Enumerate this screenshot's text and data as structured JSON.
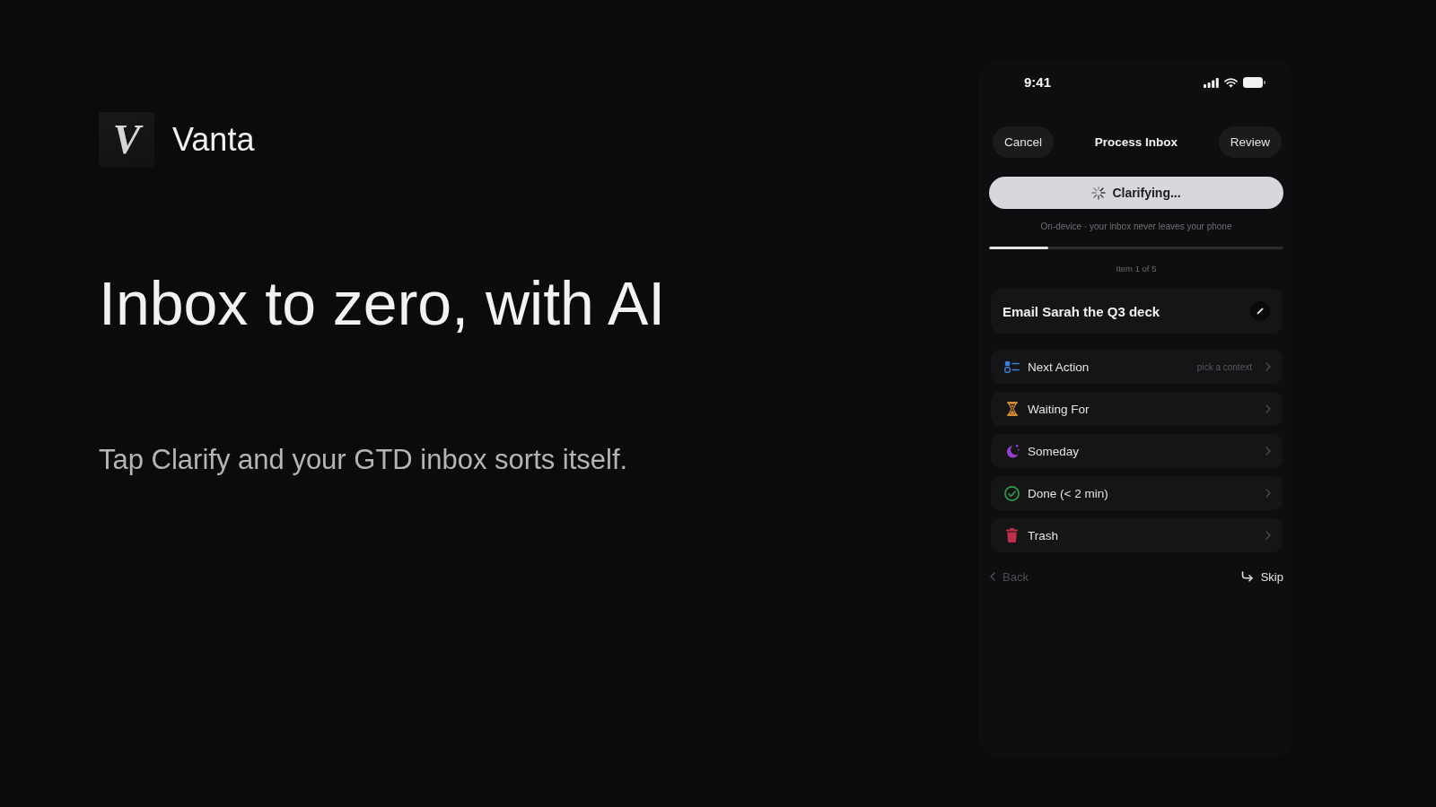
{
  "brand": {
    "logo_letter": "V",
    "name": "Vanta"
  },
  "headline": "Inbox to zero, with AI",
  "tagline": "Tap Clarify and your GTD inbox sorts itself.",
  "phone": {
    "status_bar": {
      "time": "9:41"
    },
    "nav": {
      "cancel": "Cancel",
      "title": "Process Inbox",
      "review": "Review"
    },
    "clarify_button": {
      "label": "Clarifying..."
    },
    "privacy_note": "On-device · your inbox never leaves your phone",
    "progress": {
      "level": 0.2
    },
    "counter": "Item 1 of 5",
    "item": {
      "title": "Email Sarah the Q3 deck"
    },
    "options": [
      {
        "label": "Next Action",
        "hint": "pick a context",
        "color": "#3a7fd8"
      },
      {
        "label": "Waiting For",
        "color": "#d08a35"
      },
      {
        "label": "Someday",
        "color": "#9440c8"
      },
      {
        "label": "Done (< 2 min)",
        "color": "#2f9e4c"
      },
      {
        "label": "Trash",
        "color": "#c02f4a"
      }
    ],
    "footer": {
      "back": {
        "label": "Back",
        "disabled": true
      },
      "skip": {
        "label": "Skip"
      }
    }
  }
}
